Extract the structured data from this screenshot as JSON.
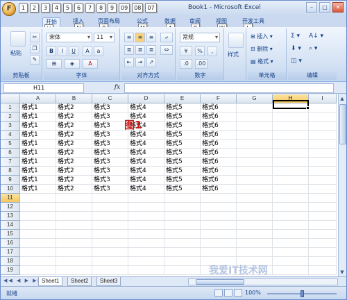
{
  "window": {
    "title": "Book1 - Microsoft Excel",
    "office_key": "F",
    "qat_keys": [
      "1",
      "2",
      "3",
      "4",
      "5",
      "6",
      "7",
      "8",
      "9",
      "09",
      "08",
      "07"
    ]
  },
  "tabs": [
    {
      "label": "开始",
      "key": "H"
    },
    {
      "label": "插入",
      "key": "N"
    },
    {
      "label": "页面布局",
      "key": "P"
    },
    {
      "label": "公式",
      "key": "M"
    },
    {
      "label": "数据",
      "key": "A"
    },
    {
      "label": "审阅",
      "key": "R"
    },
    {
      "label": "视图",
      "key": "W"
    },
    {
      "label": "开发工具",
      "key": "L"
    }
  ],
  "ribbon": {
    "clipboard": {
      "paste": "粘贴",
      "label": "剪贴板"
    },
    "font": {
      "name": "宋体",
      "size": "11",
      "bold": "B",
      "italic": "I",
      "underline": "U",
      "label": "字体"
    },
    "alignment": {
      "label": "对齐方式"
    },
    "number": {
      "format": "常规",
      "percent": "%",
      "comma": ",",
      "label": "数字"
    },
    "styles": {
      "button": "样式"
    },
    "cells": {
      "insert": "插入",
      "delete": "删除",
      "format": "格式",
      "label": "单元格"
    },
    "editing": {
      "label": "编辑"
    }
  },
  "formula_bar": {
    "name_box": "H11",
    "fx": "fx",
    "content": ""
  },
  "grid": {
    "columns": [
      "A",
      "B",
      "C",
      "D",
      "E",
      "F",
      "G",
      "H",
      "I"
    ],
    "selected_column": "H",
    "selected_row": 11,
    "rows": [
      [
        "格式1",
        "格式2",
        "格式3",
        "格式4",
        "格式5",
        "格式6"
      ],
      [
        "格式1",
        "格式2",
        "格式3",
        "格式4",
        "格式5",
        "格式6"
      ],
      [
        "格式1",
        "格式2",
        "格式3",
        "格式4",
        "格式5",
        "格式6"
      ],
      [
        "格式1",
        "格式2",
        "格式3",
        "格式4",
        "格式5",
        "格式6"
      ],
      [
        "格式1",
        "格式2",
        "格式3",
        "格式4",
        "格式5",
        "格式6"
      ],
      [
        "格式1",
        "格式2",
        "格式3",
        "格式4",
        "格式5",
        "格式6"
      ],
      [
        "格式1",
        "格式2",
        "格式3",
        "格式4",
        "格式5",
        "格式6"
      ],
      [
        "格式1",
        "格式2",
        "格式3",
        "格式4",
        "格式5",
        "格式6"
      ],
      [
        "格式1",
        "格式2",
        "格式3",
        "格式4",
        "格式5",
        "格式6"
      ],
      [
        "格式1",
        "格式2",
        "格式3",
        "格式4",
        "格式5",
        "格式6"
      ]
    ],
    "row_count": 19
  },
  "annotation": "图1",
  "sheets": [
    "Sheet1",
    "Sheet2",
    "Sheet3"
  ],
  "status": {
    "text": "就绪",
    "zoom": "100%"
  },
  "watermark": "我爱IT技术网"
}
